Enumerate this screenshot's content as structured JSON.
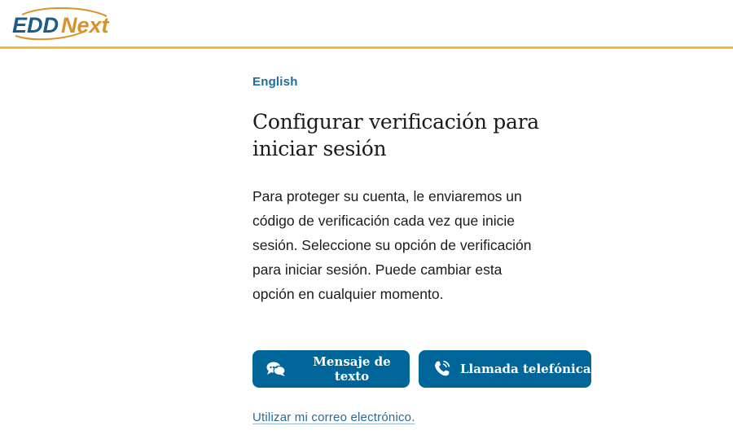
{
  "header": {
    "logo": {
      "part1": "EDD",
      "part2": "Next",
      "alt": "EDDNext"
    },
    "accent_color": "#f1be32"
  },
  "main": {
    "language_link": "English",
    "title": "Configurar verificación para iniciar sesión",
    "intro": "Para proteger su cuenta, le enviaremos un código de verificación cada vez que inicie sesión. Seleccione su opción de verificación para iniciar sesión. Puede cambiar esta opción en cualquier momento.",
    "buttons": [
      {
        "label": "Mensaje de texto",
        "icon": "chat-bubbles-icon"
      },
      {
        "label": "Llamada telefónica",
        "icon": "phone-call-icon"
      }
    ],
    "email_link": "Utilizar mi correo electrónico.",
    "colors": {
      "primary": "#00669a",
      "link": "#1d6d99",
      "text": "#1b1b1b"
    }
  }
}
